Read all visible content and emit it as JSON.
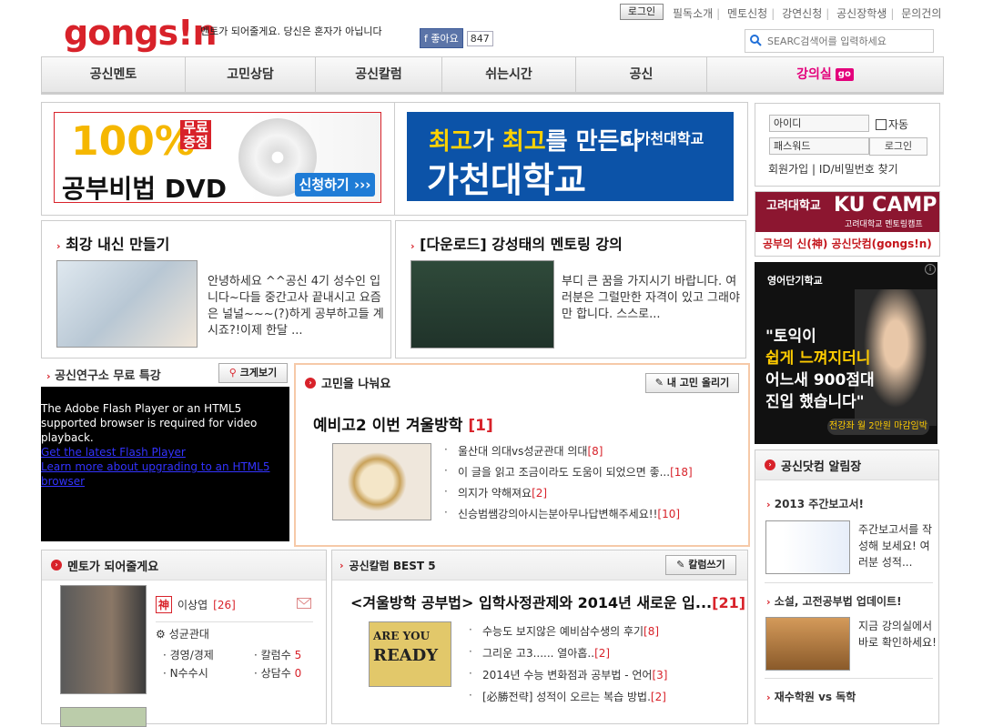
{
  "header": {
    "logo": "gongs!n",
    "tagline": "멘토가 되어줄게요. 당신은 혼자가 아닙니다",
    "fb_like": "좋아요",
    "fb_count": "847",
    "login_button": "로그인",
    "top_links": [
      "필독소개",
      "멘토신청",
      "강연신청",
      "공신장학생",
      "문의건의"
    ],
    "search_placeholder": "SEARC검색어를 입력하세요"
  },
  "nav": {
    "items": [
      "공신멘토",
      "고민상담",
      "공신칼럼",
      "쉬는시간",
      "공신",
      "강의실"
    ],
    "go_badge": "go"
  },
  "banners": {
    "dvd": {
      "big": "100%",
      "free": "무료증정",
      "title": "공부비법 DVD",
      "apply": "신청하기 ›››"
    },
    "gachon": {
      "line1_a": "최고",
      "line1_b": "가 ",
      "line1_c": "최고",
      "line1_d": "를 만든다",
      "line2": "가천대학교",
      "logo": "G 가천대학교"
    }
  },
  "login": {
    "id_placeholder": "아이디",
    "pw_placeholder": "패스워드",
    "auto_label": "자동",
    "button": "로그인",
    "signup": "회원가입",
    "find": "ID/비밀번호 찾기"
  },
  "ads": {
    "ku_t1": "고려대학교",
    "ku_t2": "KU CAMP",
    "ku_t3": "고려대학교 멘토링캠프",
    "ku_bottom": "공부의 신(神) 공신닷컴(gongs!n)",
    "eng_head": "영어단기학교",
    "eng_quote_1": "\"토익이",
    "eng_quote_2": "쉽게 느껴지더니",
    "eng_quote_3": "어느새 900점대",
    "eng_quote_4": "진입 했습니다\"",
    "eng_cta": "전강좌 월 2만원 마감임박"
  },
  "cards": {
    "left": {
      "title": "최강 내신 만들기",
      "text": "안녕하세요 ^^공신 4기 성수인 입니다~다들 중간고사 끝내시고 요즘은 널널~~~(?)하게 공부하고들 계시죠?!이제 한달 ..."
    },
    "right": {
      "title": "[다운로드] 강성태의 멘토링 강의",
      "text": "부디 큰 꿈을 가지시기 바랍니다. 여러분은 그럴만한 자격이 있고 그래야만 합니다. 스스로..."
    }
  },
  "video": {
    "title": "공신연구소 무료 특강",
    "zoom_button": "크게보기",
    "msg": "The Adobe Flash Player or an HTML5 supported browser is required for video playback.",
    "link1": "Get the latest Flash Player",
    "link2": "Learn more about upgrading to an HTML5 browser"
  },
  "worry": {
    "title": "고민을 나눠요",
    "post_button": "내 고민 올리기",
    "headline": "예비고2 이번 겨울방학",
    "headline_count": "[1]",
    "items": [
      {
        "text": "울산대 의대vs성균관대 의대",
        "count": "[8]"
      },
      {
        "text": "이 글을 읽고 조금이라도 도움이 되었으면 좋...",
        "count": "[18]"
      },
      {
        "text": "의지가 약해져요",
        "count": "[2]"
      },
      {
        "text": "신승범쌤강의아시는분아무나답변해주세요!!",
        "count": "[10]"
      }
    ]
  },
  "mentor": {
    "title": "멘토가 되어줄게요",
    "sin": "神",
    "name": "이상엽",
    "count": "[26]",
    "school": "성균관대",
    "major": "경영/경제",
    "type": "N수수시",
    "columns_label": "칼럼수",
    "columns": "5",
    "consult_label": "상담수",
    "consult": "0"
  },
  "column": {
    "title": "공신칼럼 BEST 5",
    "write_button": "칼럼쓰기",
    "headline": "<겨울방학 공부법> 입학사정관제와 2014년 새로운 입...",
    "headline_count": "[21]",
    "thumb_line1": "ARE YOU",
    "thumb_line2": "READY",
    "items": [
      {
        "text": "수능도 보지않은 예비삼수생의 후기",
        "count": "[8]"
      },
      {
        "text": "그리운 고3...... 열아홉..",
        "count": "[2]"
      },
      {
        "text": "2014년 수능 변화점과 공부법 - 언어",
        "count": "[3]"
      },
      {
        "text": "[必勝전략] 성적이 오르는 복습 방법.",
        "count": "[2]"
      }
    ]
  },
  "notices": {
    "title": "공신닷컴 알림장",
    "items": [
      {
        "title": "2013 주간보고서!",
        "text": "주간보고서를 작성해 보세요! 여러분 성적..."
      },
      {
        "title": "소설, 고전공부법 업데이트!",
        "text": "지금 강의실에서 바로 확인하세요!"
      },
      {
        "title": "재수학원 vs 독학"
      }
    ]
  }
}
